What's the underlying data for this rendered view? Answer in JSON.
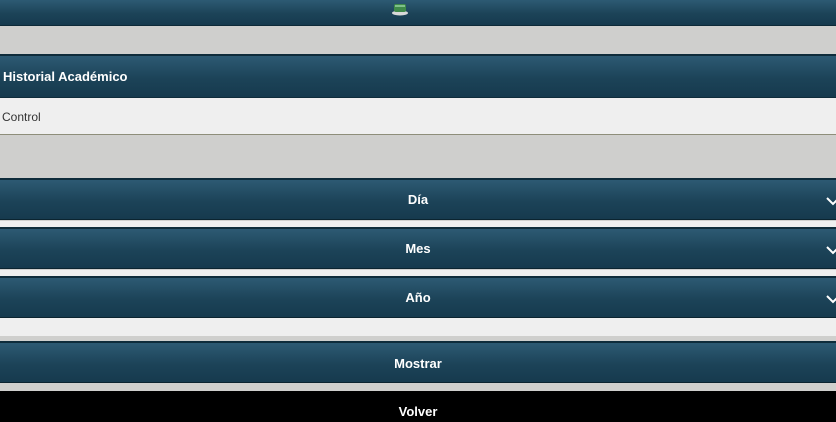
{
  "header": {
    "title": "Historial Académico"
  },
  "panel": {
    "label": "Control"
  },
  "selects": {
    "day": {
      "label": "Día"
    },
    "month": {
      "label": "Mes"
    },
    "year": {
      "label": "Año"
    }
  },
  "buttons": {
    "show": "Mostrar",
    "back": "Volver"
  },
  "colors": {
    "bar": "#1c4358",
    "panel": "#efefef",
    "page": "#cfcfcd",
    "back_button": "#000000"
  },
  "icons": {
    "logo": "crest-logo-icon",
    "chevron": "chevron-down-icon"
  }
}
